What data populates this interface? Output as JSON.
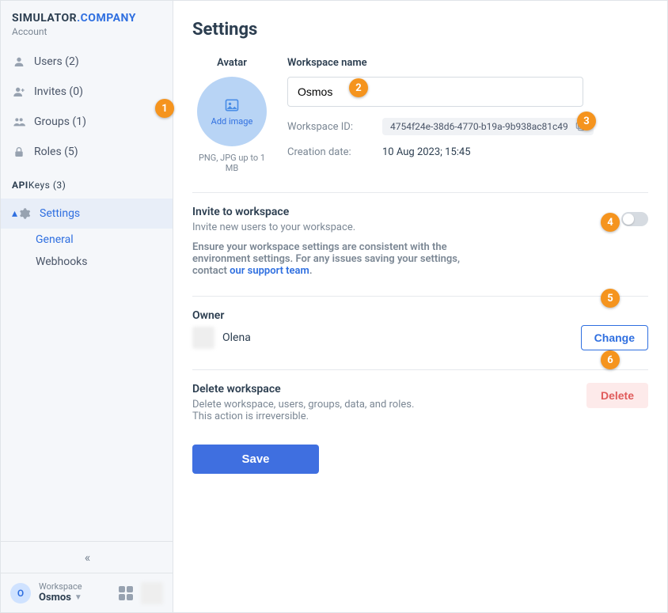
{
  "brand": {
    "a": "SIMULATOR",
    "b": ".COMPANY",
    "sub": "Account"
  },
  "nav": {
    "users": "Users (2)",
    "invites": "Invites (0)",
    "groups": "Groups (1)",
    "roles": "Roles (5)",
    "api_prefix": "API",
    "keys": "Keys (3)",
    "settings": "Settings",
    "general": "General",
    "webhooks": "Webhooks"
  },
  "collapse_glyph": "«",
  "footer": {
    "badge": "O",
    "label": "Workspace",
    "name": "Osmos"
  },
  "page": {
    "title": "Settings",
    "avatar_label": "Avatar",
    "add_image": "Add image",
    "avatar_hint": "PNG, JPG up to 1 MB",
    "name_label": "Workspace name",
    "name_value": "Osmos",
    "ws_id_label": "Workspace ID:",
    "ws_id_value": "4754f24e-38d6-4770-b19a-9b938ac81c49",
    "creation_label": "Creation date:",
    "creation_value": "10 Aug 2023; 15:45",
    "invite_head": "Invite to workspace",
    "invite_desc1": "Invite new users to your workspace.",
    "invite_desc2a": "Ensure your workspace settings are consistent with the environment settings. For any issues saving your settings, contact ",
    "invite_link": "our support team",
    "invite_desc2b": ".",
    "owner_head": "Owner",
    "owner_name": "Olena",
    "change_btn": "Change",
    "delete_head": "Delete workspace",
    "delete_desc1": "Delete workspace, users, groups, data, and roles.",
    "delete_desc2": "This action is irreversible.",
    "delete_btn": "Delete",
    "save_btn": "Save"
  },
  "annotations": [
    "1",
    "2",
    "3",
    "4",
    "5",
    "6"
  ]
}
